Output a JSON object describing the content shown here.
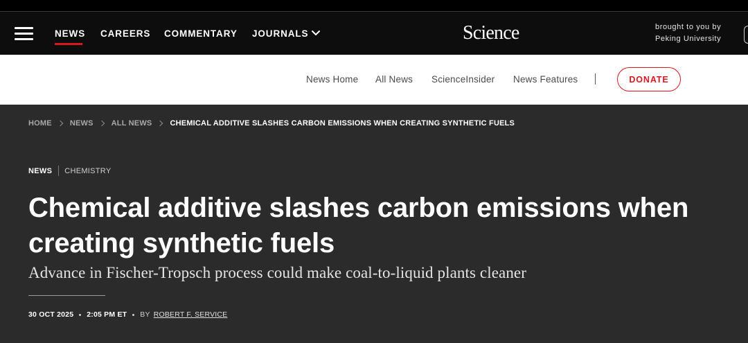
{
  "header": {
    "nav": {
      "news": "NEWS",
      "careers": "CAREERS",
      "commentary": "COMMENTARY",
      "journals": "JOURNALS"
    },
    "logo": "Science",
    "sponsor": {
      "line1": "brought to you by",
      "line2": "Peking University"
    },
    "accent_color": "#d9171e"
  },
  "subnav": {
    "items": [
      "News Home",
      "All News",
      "ScienceInsider",
      "News Features"
    ],
    "donate": "DONATE"
  },
  "article": {
    "breadcrumb": [
      "HOME",
      "NEWS",
      "ALL NEWS",
      "CHEMICAL ADDITIVE SLASHES CARBON EMISSIONS WHEN CREATING SYNTHETIC FUELS"
    ],
    "tags": [
      "NEWS",
      "CHEMISTRY"
    ],
    "title": "Chemical additive slashes carbon emissions when creating synthetic fuels",
    "dek": "Advance in Fischer-Tropsch process could make coal-to-liquid plants cleaner",
    "date": "30 OCT 2025",
    "time": "2:05 PM ET",
    "by": "BY",
    "author": "ROBERT F. SERVICE"
  }
}
